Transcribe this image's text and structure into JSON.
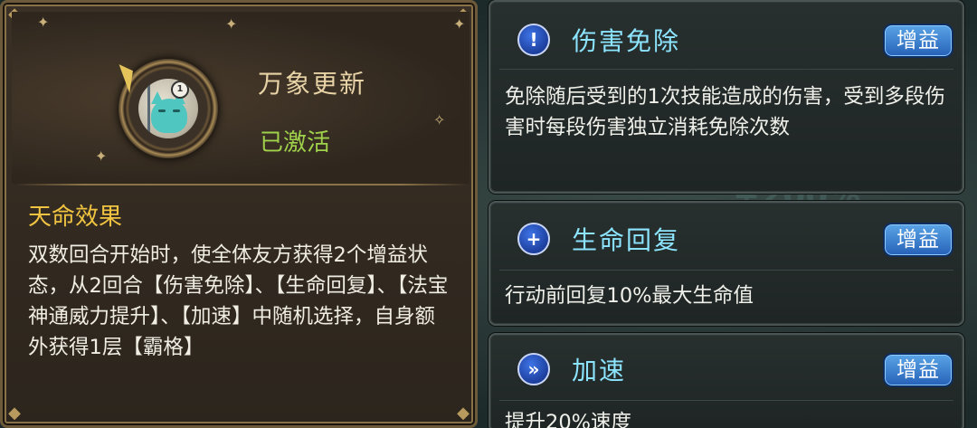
{
  "destiny_panel": {
    "title": "万象更新",
    "status": "已激活",
    "emblem_badge": "1",
    "section_title": "天命效果",
    "description": "双数回合开始时，使全体友方获得2个增益状态，从2回合【伤害免除】、【生命回复】、【法宝神通威力提升】、【加速】中随机选择，自身额外获得1层【霸格】"
  },
  "buffs": [
    {
      "name": "伤害免除",
      "tag": "增益",
      "icon": "shield-exclaim-icon",
      "icon_glyph": "!",
      "description": "免除随后受到的1次技能造成的伤害，受到多段伤害时每段伤害独立消耗免除次数"
    },
    {
      "name": "生命回复",
      "tag": "增益",
      "icon": "plus-icon",
      "icon_glyph": "+",
      "description": "行动前回复10%最大生命值"
    },
    {
      "name": "加速",
      "tag": "增益",
      "icon": "speed-boot-icon",
      "icon_glyph": "»",
      "description": "提升20%速度"
    }
  ],
  "background_text": "+200%",
  "colors": {
    "title": "#e8d3a6",
    "status_active": "#9fd14b",
    "section_title": "#f0c441",
    "buff_name": "#8ce4ff",
    "tag_bg": "#2661b8"
  }
}
